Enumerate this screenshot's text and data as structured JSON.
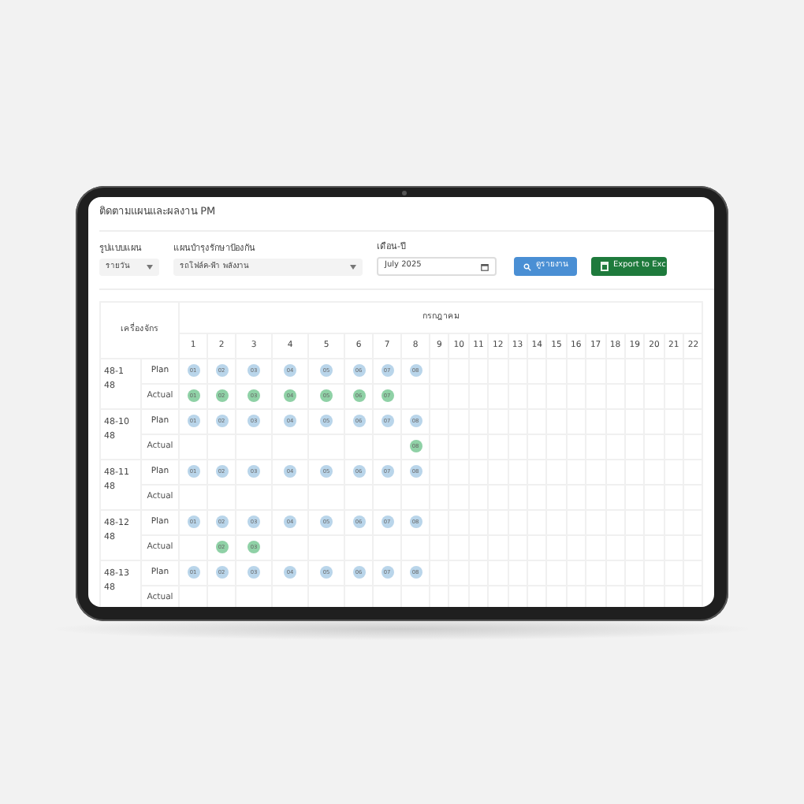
{
  "title": "ติดตามแผนและผลงาน PM",
  "filters": [
    {
      "kind": "select",
      "label": "รูปแบบแผน",
      "value": "รายวัน"
    },
    {
      "kind": "select",
      "label": "แผนบำรุงรักษาป้องกัน",
      "value": "รถโฟล์ค-ฟ้า พลังงาน"
    },
    {
      "kind": "date",
      "label": "เดือน-ปี",
      "value": "July 2025"
    }
  ],
  "buttons": [
    {
      "kind": "search",
      "label": "ดูรายงาน"
    },
    {
      "kind": "export",
      "label": "Export to Exc"
    }
  ],
  "table": {
    "machine_header": "เครื่องจักร",
    "month": "กรกฎาคม",
    "days": [
      "1",
      "2",
      "3",
      "4",
      "5",
      "6",
      "7",
      "8",
      "9",
      "10",
      "11",
      "12",
      "13",
      "14",
      "15",
      "16",
      "17",
      "18",
      "19",
      "20",
      "21",
      "22"
    ],
    "machines": [
      {
        "name": "48-1 48",
        "rows": [
          {
            "kind": "plan",
            "type": "Plan",
            "cells": [
              "01",
              "02",
              "03",
              "04",
              "05",
              "06",
              "07",
              "08"
            ]
          },
          {
            "kind": "actual",
            "type": "Actual",
            "cells": [
              "01",
              "02",
              "03",
              "04",
              "05",
              "06",
              "07"
            ]
          }
        ]
      },
      {
        "name": "48-10 48",
        "rows": [
          {
            "kind": "plan",
            "type": "Plan",
            "cells": [
              "01",
              "02",
              "03",
              "04",
              "05",
              "06",
              "07",
              "08"
            ]
          },
          {
            "kind": "actual",
            "type": "Actual",
            "cells": [
              null,
              null,
              null,
              null,
              null,
              null,
              null,
              "08"
            ]
          }
        ]
      },
      {
        "name": "48-11 48",
        "rows": [
          {
            "kind": "plan",
            "type": "Plan",
            "cells": [
              "01",
              "02",
              "03",
              "04",
              "05",
              "06",
              "07",
              "08"
            ]
          },
          {
            "kind": "actual",
            "type": "Actual",
            "cells": []
          }
        ]
      },
      {
        "name": "48-12 48",
        "rows": [
          {
            "kind": "plan",
            "type": "Plan",
            "cells": [
              "01",
              "02",
              "03",
              "04",
              "05",
              "06",
              "07",
              "08"
            ]
          },
          {
            "kind": "actual",
            "type": "Actual",
            "cells": [
              null,
              "02",
              "03"
            ]
          }
        ]
      },
      {
        "name": "48-13 48",
        "rows": [
          {
            "kind": "plan",
            "type": "Plan",
            "cells": [
              "01",
              "02",
              "03",
              "04",
              "05",
              "06",
              "07",
              "08"
            ]
          },
          {
            "kind": "actual",
            "type": "Actual",
            "cells": []
          }
        ]
      }
    ]
  }
}
